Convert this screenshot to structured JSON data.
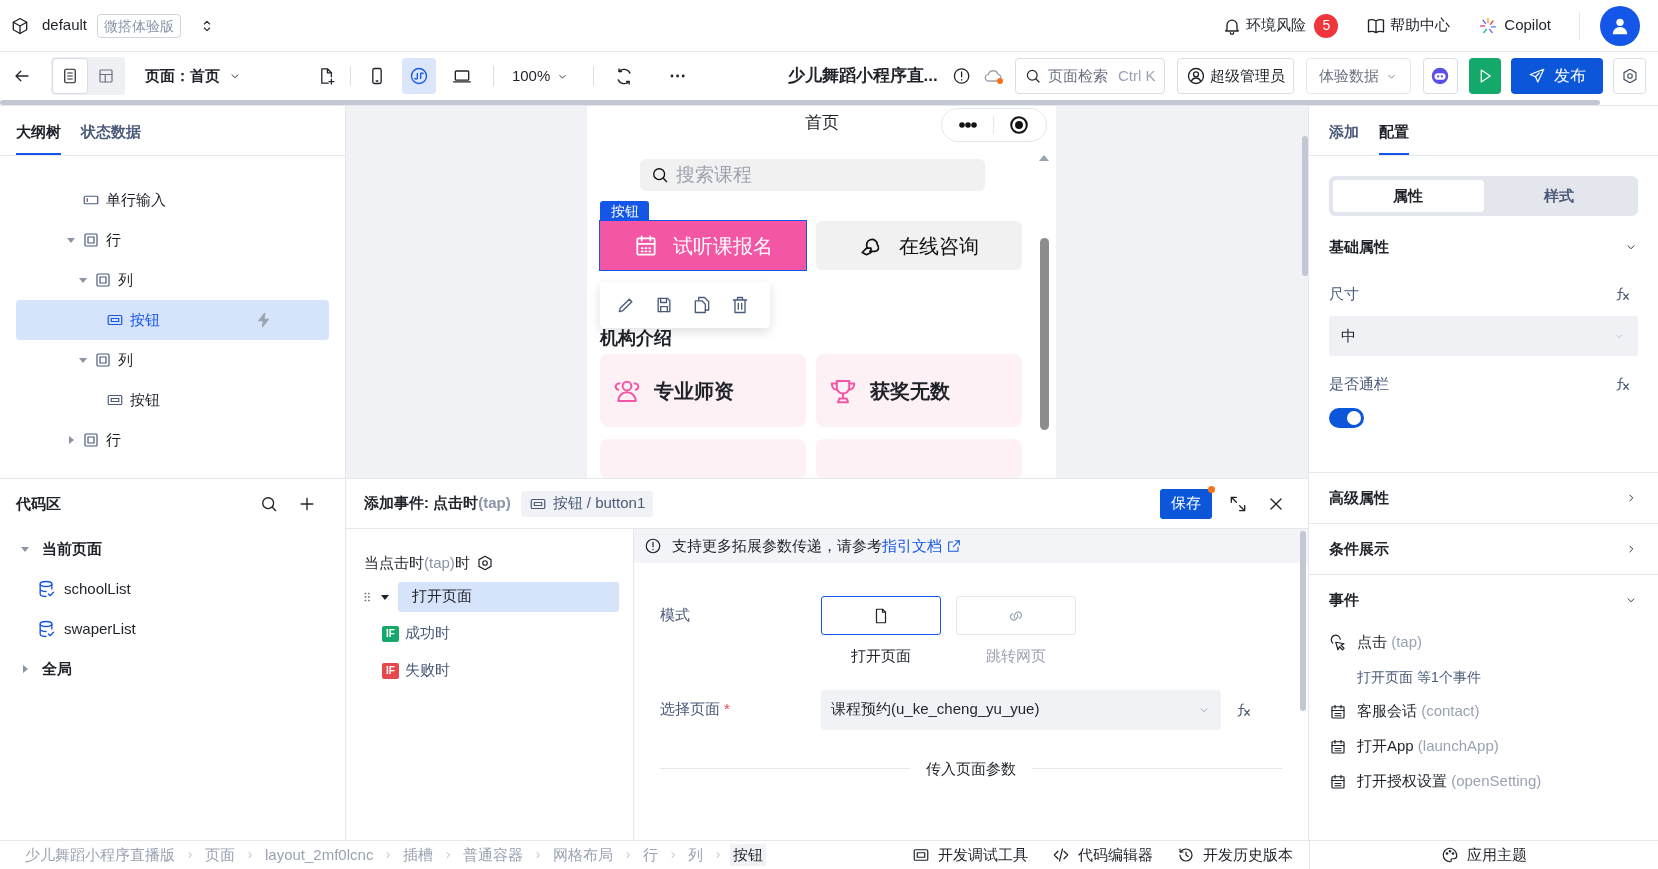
{
  "top_bar": {
    "workspace": "default",
    "edition_badge": "微搭体验版",
    "alerts": {
      "label": "环境风险",
      "count": "5"
    },
    "help": "帮助中心",
    "copilot": "Copilot"
  },
  "toolbar": {
    "views": [
      {
        "kind": "page",
        "selected": true
      },
      {
        "kind": "layout",
        "selected": false
      }
    ],
    "page_select": "页面：首页",
    "devices": [
      {
        "kind": "phone",
        "selected": false
      },
      {
        "kind": "miniprogram",
        "selected": true
      },
      {
        "kind": "desktop",
        "selected": false
      }
    ],
    "zoom": "100%",
    "app_title": "少儿舞蹈小程序直...",
    "search": {
      "placeholder": "页面检索",
      "shortcut": "Ctrl K"
    },
    "role": "超级管理员",
    "data_source": "体验数据",
    "publish": "发布"
  },
  "outline": {
    "tabs": [
      {
        "label": "大纲树",
        "selected": true
      },
      {
        "label": "状态数据",
        "selected": false
      }
    ],
    "tree": [
      {
        "label": "单行输入",
        "kind": "input",
        "selected": false
      },
      {
        "label": "行",
        "kind": "container",
        "expanded": true,
        "selected": false,
        "children": [
          {
            "label": "列",
            "kind": "container",
            "expanded": true,
            "selected": false,
            "children": [
              {
                "label": "按钮",
                "kind": "button",
                "selected": true
              }
            ]
          },
          {
            "label": "列",
            "kind": "container",
            "expanded": true,
            "selected": false,
            "children": [
              {
                "label": "按钮",
                "kind": "button",
                "selected": false
              }
            ]
          }
        ]
      },
      {
        "label": "行",
        "kind": "container",
        "expanded": false,
        "selected": false
      }
    ]
  },
  "code_area": {
    "title": "代码区",
    "tree": [
      {
        "label": "当前页面",
        "expanded": true,
        "children": [
          {
            "label": "schoolList"
          },
          {
            "label": "swaperList"
          }
        ]
      },
      {
        "label": "全局",
        "expanded": false
      }
    ]
  },
  "preview": {
    "title": "首页",
    "search_placeholder": "搜索课程",
    "selection_tag": "按钮",
    "buttons": [
      {
        "label": "试听课报名",
        "kind": "primary",
        "selected": true
      },
      {
        "label": "在线咨询",
        "kind": "secondary",
        "selected": false
      }
    ],
    "section_title": "机构介绍",
    "features": [
      {
        "label": "专业师资",
        "kind": "teachers"
      },
      {
        "label": "获奖无数",
        "kind": "awards"
      }
    ]
  },
  "event_editor": {
    "title": "添加事件: 点击时",
    "trigger": "(tap)",
    "target": "按钮 / button1",
    "save": "保存",
    "unsaved": true,
    "trigger_line": {
      "prefix": "当点击时",
      "hint": "(tap)",
      "suffix": "时"
    },
    "actions": [
      {
        "label": "打开页面",
        "kind": "action",
        "selected": true
      },
      {
        "label": "成功时",
        "kind": "success",
        "badge": "IF",
        "selected": false
      },
      {
        "label": "失败时",
        "kind": "failure",
        "badge": "IF",
        "selected": false
      }
    ],
    "notice": {
      "text": "支持更多拓展参数传递，请参考",
      "link": "指引文档"
    },
    "mode": {
      "label": "模式",
      "options": [
        {
          "label": "打开页面",
          "kind": "page",
          "selected": true
        },
        {
          "label": "跳转网页",
          "kind": "link",
          "selected": false
        }
      ]
    },
    "page_field": {
      "label": "选择页面",
      "required_mark": "*",
      "value": "课程预约(u_ke_cheng_yu_yue)"
    },
    "params_divider": "传入页面参数"
  },
  "inspector": {
    "tabs": [
      {
        "label": "添加",
        "selected": false
      },
      {
        "label": "配置",
        "selected": true
      }
    ],
    "segments": [
      {
        "label": "属性",
        "selected": true
      },
      {
        "label": "样式",
        "selected": false
      }
    ],
    "sections": [
      {
        "title": "基础属性",
        "expanded": true,
        "fields": [
          {
            "kind": "select",
            "label": "尺寸",
            "value": "中"
          },
          {
            "kind": "toggle",
            "label": "是否通栏",
            "on": true
          }
        ]
      },
      {
        "title": "高级属性",
        "expanded": false
      },
      {
        "title": "条件展示",
        "expanded": false
      },
      {
        "title": "事件",
        "expanded": true,
        "events": [
          {
            "label": "点击",
            "hint": "(tap)",
            "kind": "tap",
            "summary": "打开页面 等1个事件"
          },
          {
            "label": "客服会话",
            "hint": "(contact)",
            "kind": "other"
          },
          {
            "label": "打开App",
            "hint": "(launchApp)",
            "kind": "other"
          },
          {
            "label": "打开授权设置",
            "hint": "(openSetting)",
            "kind": "other"
          }
        ]
      }
    ]
  },
  "breadcrumb": [
    {
      "label": "少儿舞蹈小程序直播版",
      "selected": false
    },
    {
      "label": "页面",
      "selected": false
    },
    {
      "label": "layout_2mf0lcnc",
      "selected": false
    },
    {
      "label": "插槽",
      "selected": false
    },
    {
      "label": "普通容器",
      "selected": false
    },
    {
      "label": "网格布局",
      "selected": false
    },
    {
      "label": "行",
      "selected": false
    },
    {
      "label": "列",
      "selected": false
    },
    {
      "label": "按钮",
      "selected": true
    }
  ],
  "footer_tools": [
    {
      "label": "开发调试工具",
      "kind": "debug"
    },
    {
      "label": "代码编辑器",
      "kind": "code"
    },
    {
      "label": "开发历史版本",
      "kind": "history"
    }
  ],
  "theme_button": "应用主题"
}
